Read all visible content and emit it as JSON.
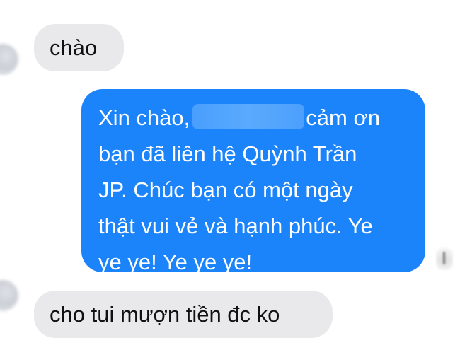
{
  "conversation": {
    "messages": [
      {
        "direction": "incoming",
        "text": "chào"
      },
      {
        "direction": "outgoing",
        "line_1_start": "Xin chào,",
        "line_1_end": "cảm ơn",
        "line_2": "bạn đã liên hệ Quỳnh Trần",
        "line_3": "JP. Chúc bạn có một ngày",
        "line_4": "thật vui vẻ và hạnh phúc. Ye",
        "line_5": "ye ye! Ye ye ye!"
      },
      {
        "direction": "incoming",
        "text": "cho tui mượn tiền đc ko"
      }
    ]
  },
  "colors": {
    "incoming_bubble": "#e9e9eb",
    "outgoing_bubble": "#1c84fa",
    "redaction": "#5aaafd"
  }
}
